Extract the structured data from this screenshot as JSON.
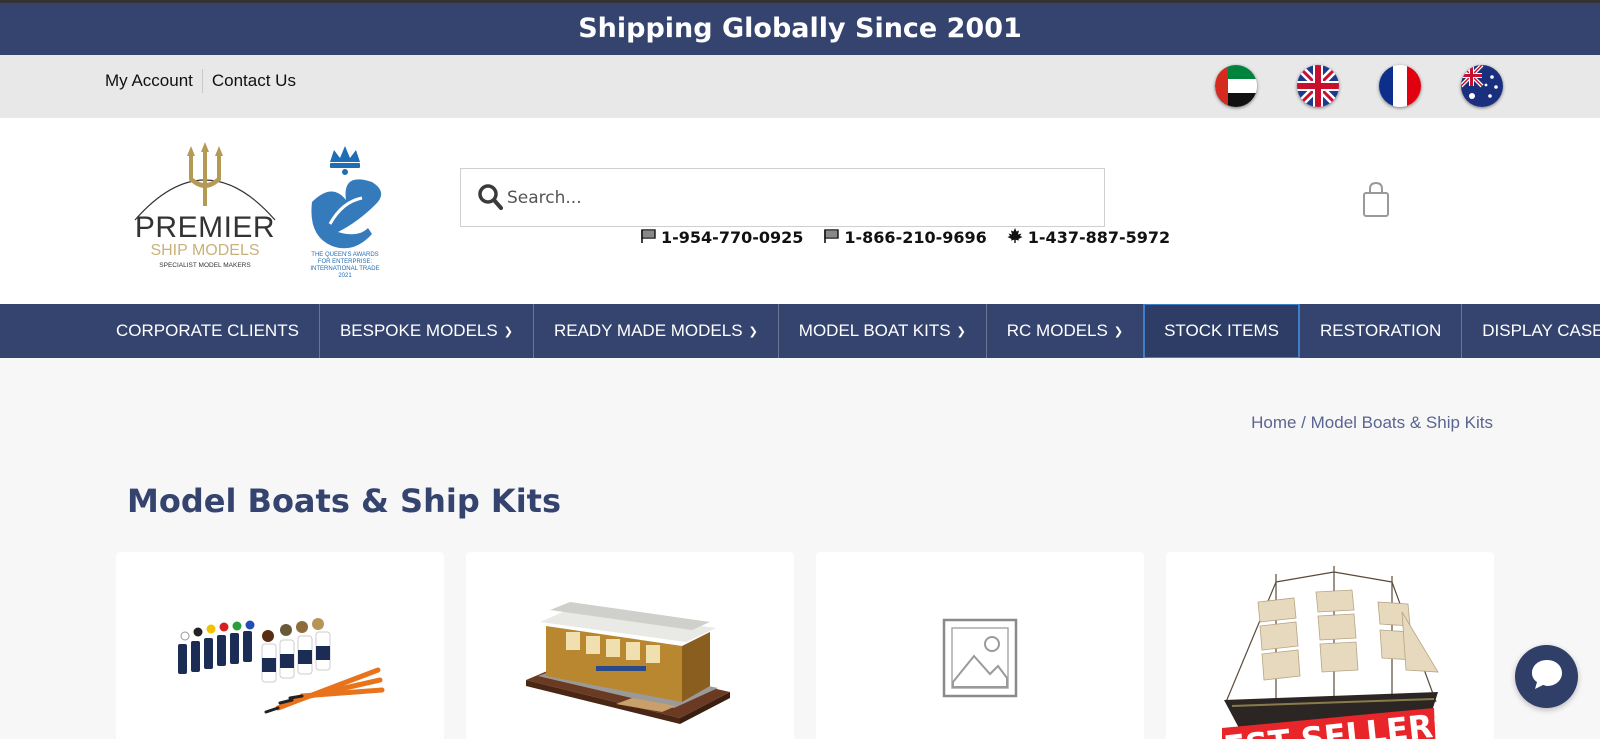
{
  "promo": {
    "text": "Shipping Globally Since 2001"
  },
  "utility": {
    "my_account": "My Account",
    "contact_us": "Contact Us",
    "flags": [
      "uae-flag-icon",
      "uk-flag-icon",
      "france-flag-icon",
      "australia-flag-icon"
    ]
  },
  "logo": {
    "line1": "PREMIER",
    "line2": "SHIP MODELS",
    "tagline": "SPECIALIST MODEL MAKERS"
  },
  "award": {
    "line1": "THE QUEEN'S AWARDS",
    "line2": "FOR ENTERPRISE:",
    "line3": "INTERNATIONAL TRADE",
    "year": "2021"
  },
  "search": {
    "placeholder": "Search..."
  },
  "phones": [
    {
      "icon": "us-flag-icon",
      "number": "1-954-770-0925"
    },
    {
      "icon": "us-flag-icon",
      "number": "1-866-210-9696"
    },
    {
      "icon": "maple-leaf-icon",
      "number": "1-437-887-5972"
    }
  ],
  "nav": {
    "items": [
      {
        "label": "CORPORATE CLIENTS",
        "dropdown": false
      },
      {
        "label": "BESPOKE MODELS",
        "dropdown": true
      },
      {
        "label": "READY MADE MODELS",
        "dropdown": true
      },
      {
        "label": "MODEL BOAT KITS",
        "dropdown": true
      },
      {
        "label": "RC MODELS",
        "dropdown": true
      },
      {
        "label": "STOCK ITEMS",
        "dropdown": false
      },
      {
        "label": "RESTORATION",
        "dropdown": false
      },
      {
        "label": "DISPLAY CASES",
        "dropdown": false
      }
    ]
  },
  "breadcrumb": {
    "home": "Home",
    "separator": " / ",
    "current": "Model Boats & Ship Kits"
  },
  "page": {
    "title": "Model Boats & Ship Kits"
  },
  "products": {
    "badge": "BEST SELLERS"
  },
  "colors": {
    "brand": "#35446f",
    "accent": "#3f7ec9",
    "gold": "#b59a55"
  }
}
